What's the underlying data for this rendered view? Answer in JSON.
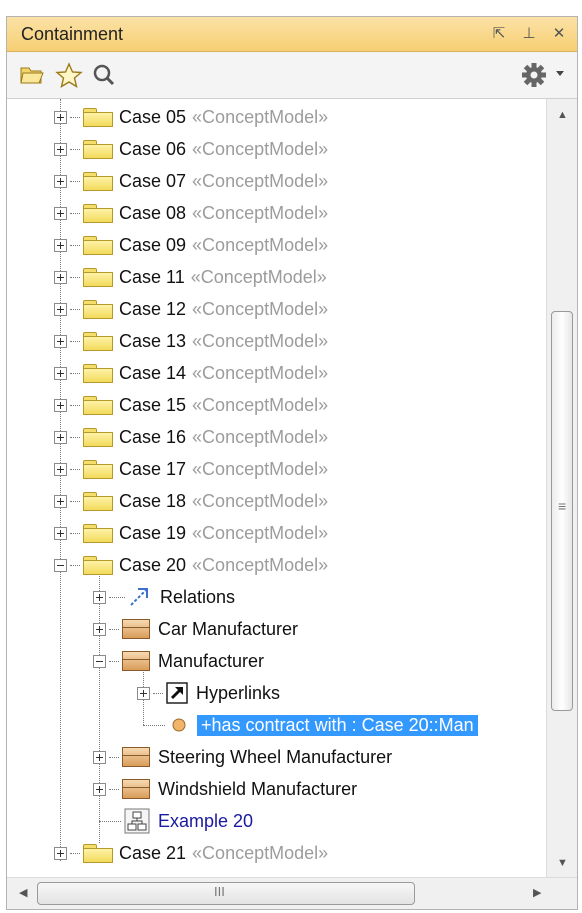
{
  "panel": {
    "title": "Containment",
    "title_icons": [
      "restore-icon",
      "pin-icon",
      "close-icon"
    ],
    "title_glyphs": [
      "⇱",
      "⊥",
      "✕"
    ]
  },
  "toolbar": {
    "icons": [
      "open-folder-icon",
      "star-icon",
      "search-icon",
      "gear-icon",
      "dropdown-icon"
    ]
  },
  "tree": {
    "cases": [
      {
        "label": "Case 05",
        "stereotype": "«ConceptModel»"
      },
      {
        "label": "Case 06",
        "stereotype": "«ConceptModel»"
      },
      {
        "label": "Case 07",
        "stereotype": "«ConceptModel»"
      },
      {
        "label": "Case 08",
        "stereotype": "«ConceptModel»"
      },
      {
        "label": "Case 09",
        "stereotype": "«ConceptModel»"
      },
      {
        "label": "Case 11",
        "stereotype": "«ConceptModel»"
      },
      {
        "label": "Case 12",
        "stereotype": "«ConceptModel»"
      },
      {
        "label": "Case 13",
        "stereotype": "«ConceptModel»"
      },
      {
        "label": "Case 14",
        "stereotype": "«ConceptModel»"
      },
      {
        "label": "Case 15",
        "stereotype": "«ConceptModel»"
      },
      {
        "label": "Case 16",
        "stereotype": "«ConceptModel»"
      },
      {
        "label": "Case 17",
        "stereotype": "«ConceptModel»"
      },
      {
        "label": "Case 18",
        "stereotype": "«ConceptModel»"
      },
      {
        "label": "Case 19",
        "stereotype": "«ConceptModel»"
      },
      {
        "label": "Case 20",
        "stereotype": "«ConceptModel»"
      }
    ],
    "case20_children": {
      "relations": "Relations",
      "car_manufacturer": "Car Manufacturer",
      "manufacturer": "Manufacturer",
      "hyperlinks": "Hyperlinks",
      "property": "+has contract with : Case 20::Man",
      "steering_wheel_manufacturer": "Steering Wheel Manufacturer",
      "windshield_manufacturer": "Windshield Manufacturer",
      "diagram": "Example 20"
    },
    "last_case": {
      "label": "Case 21",
      "stereotype": "«ConceptModel»"
    }
  },
  "scrollbars": {
    "grip": "≡",
    "hgrip": "III"
  }
}
